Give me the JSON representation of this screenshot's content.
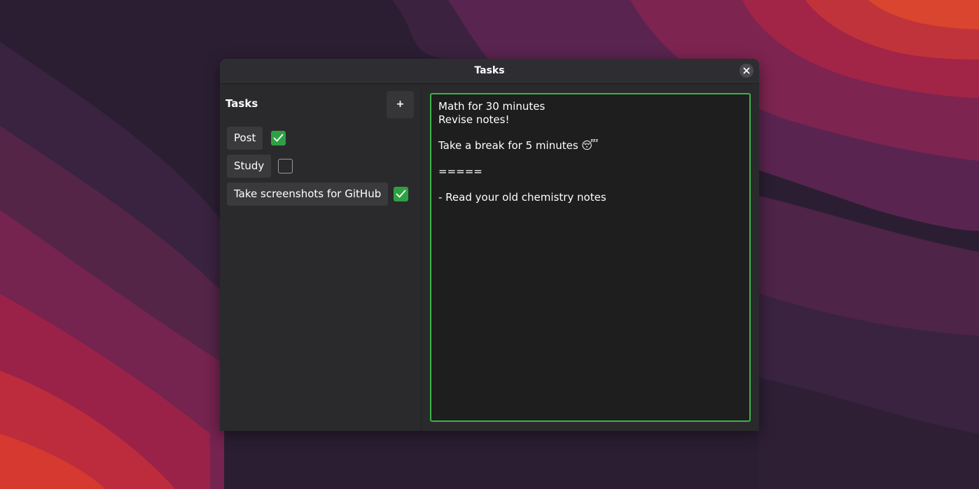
{
  "window": {
    "title": "Tasks"
  },
  "sidebar": {
    "heading": "Tasks",
    "add_label": "+",
    "tasks": [
      {
        "label": "Post",
        "checked": true
      },
      {
        "label": "Study",
        "checked": false
      },
      {
        "label": "Take screenshots for GitHub",
        "checked": true
      }
    ]
  },
  "editor": {
    "content": "Math for 30 minutes\nRevise notes!\n\nTake a break for 5 minutes 😴\n\n=====\n\n- Read your old chemistry notes"
  },
  "colors": {
    "accent": "#3cb44a",
    "checkbox_checked": "#2ea043",
    "window_bg": "#2a2a2d",
    "editor_bg": "#1e1e1e"
  },
  "icons": {
    "close": "close-icon",
    "check": "checkmark-icon"
  }
}
